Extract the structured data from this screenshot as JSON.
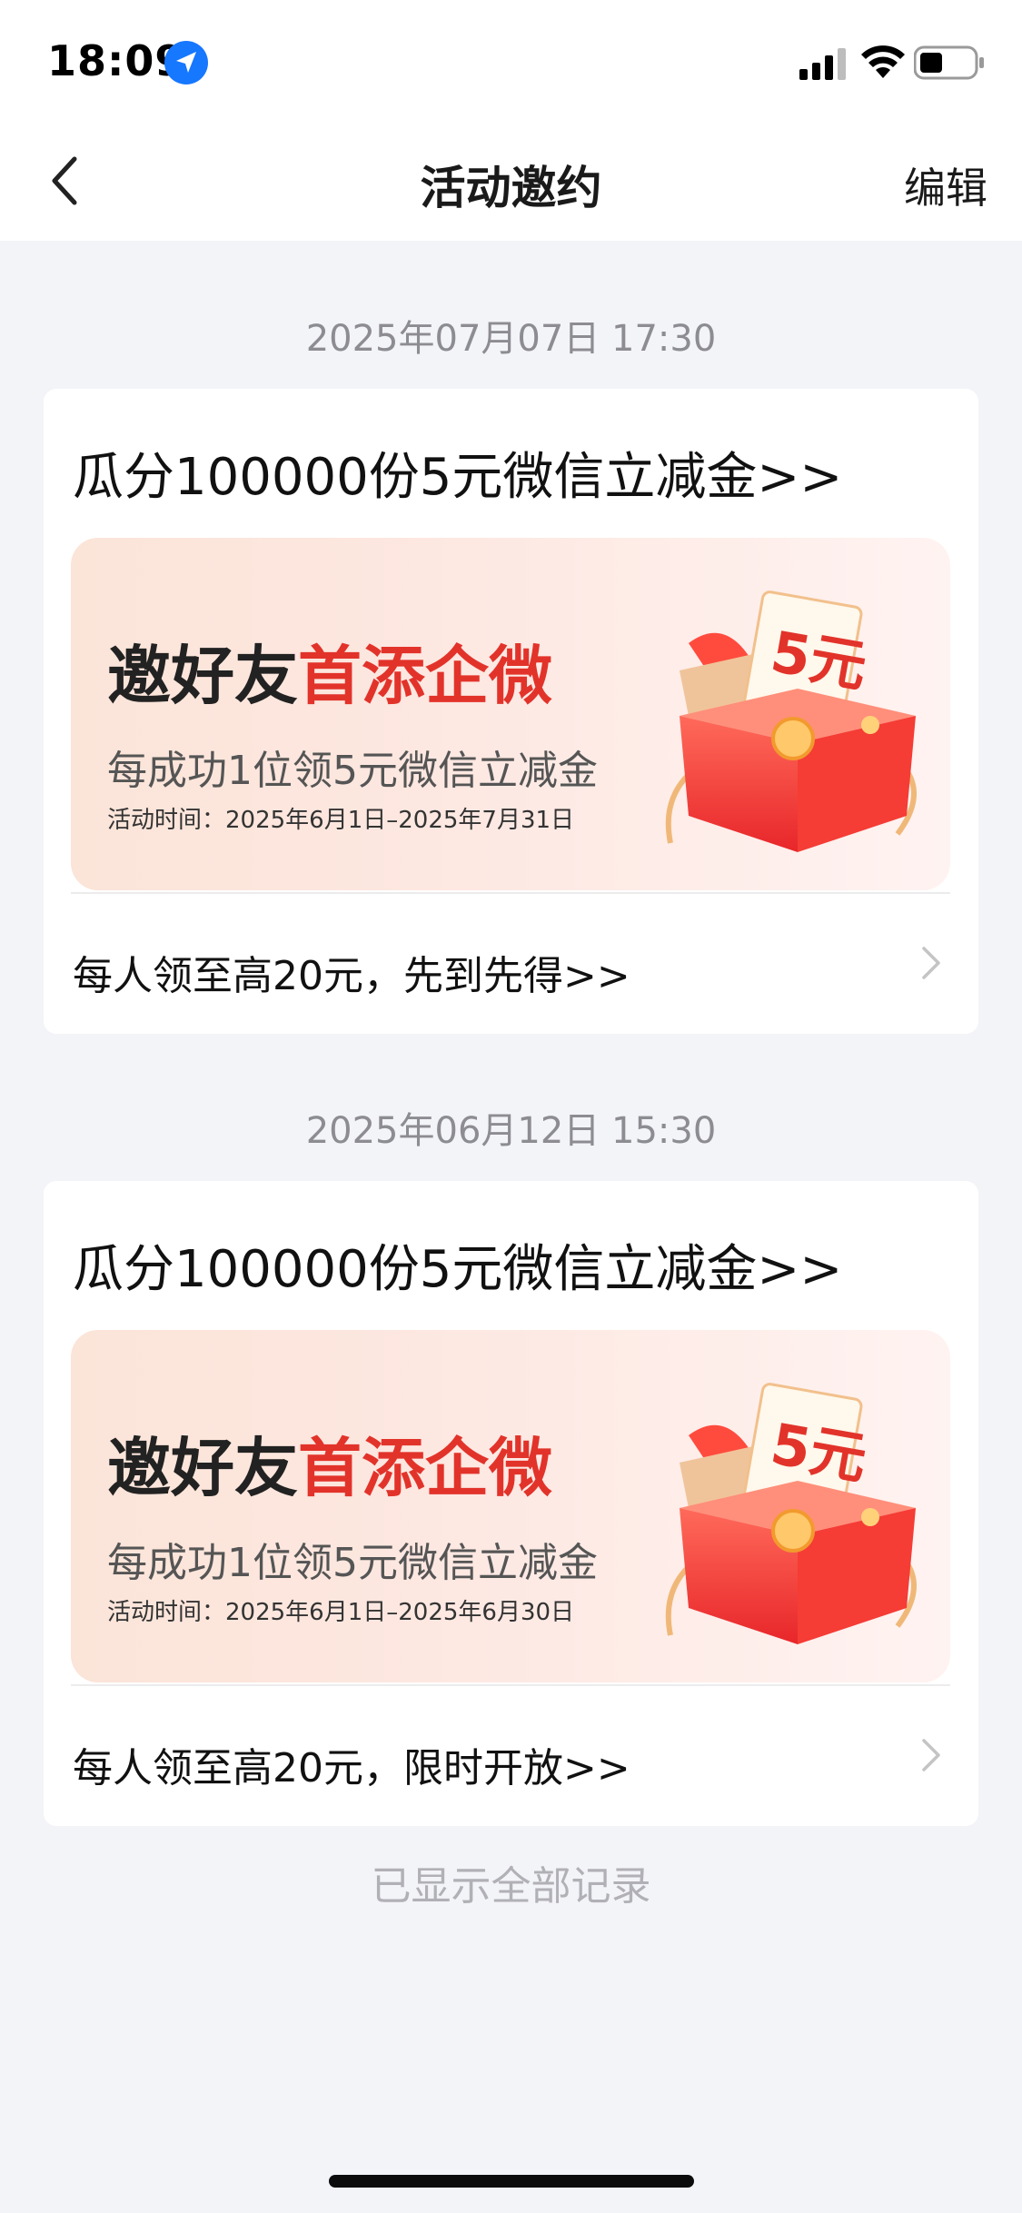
{
  "status_bar": {
    "time": "18:09",
    "icons": [
      "location-arrow-icon",
      "cellular-signal-icon",
      "wifi-icon",
      "battery-icon"
    ]
  },
  "nav": {
    "back_icon": "chevron-left-icon",
    "title": "活动邀约",
    "edit_label": "编辑"
  },
  "messages": [
    {
      "timestamp": "2025年07月07日 17:30",
      "title": "瓜分100000份5元微信立减金>>",
      "banner": {
        "head_main": "邀好友",
        "head_accent": "首添企微",
        "subtitle": "每成功1位领5元微信立减金",
        "period": "活动时间：2025年6月1日–2025年7月31日",
        "badge": "5元"
      },
      "footer": "每人领至高20元，先到先得>>"
    },
    {
      "timestamp": "2025年06月12日 15:30",
      "title": "瓜分100000份5元微信立减金>>",
      "banner": {
        "head_main": "邀好友",
        "head_accent": "首添企微",
        "subtitle": "每成功1位领5元微信立减金",
        "period": "活动时间：2025年6月1日–2025年6月30日",
        "badge": "5元"
      },
      "footer": "每人领至高20元，限时开放>>"
    }
  ],
  "end_note": "已显示全部记录",
  "colors": {
    "accent_red": "#e2332a",
    "background": "#f3f4f8",
    "card": "#ffffff",
    "timestamp_gray": "#8c8c92",
    "status_blue": "#1677ff"
  }
}
